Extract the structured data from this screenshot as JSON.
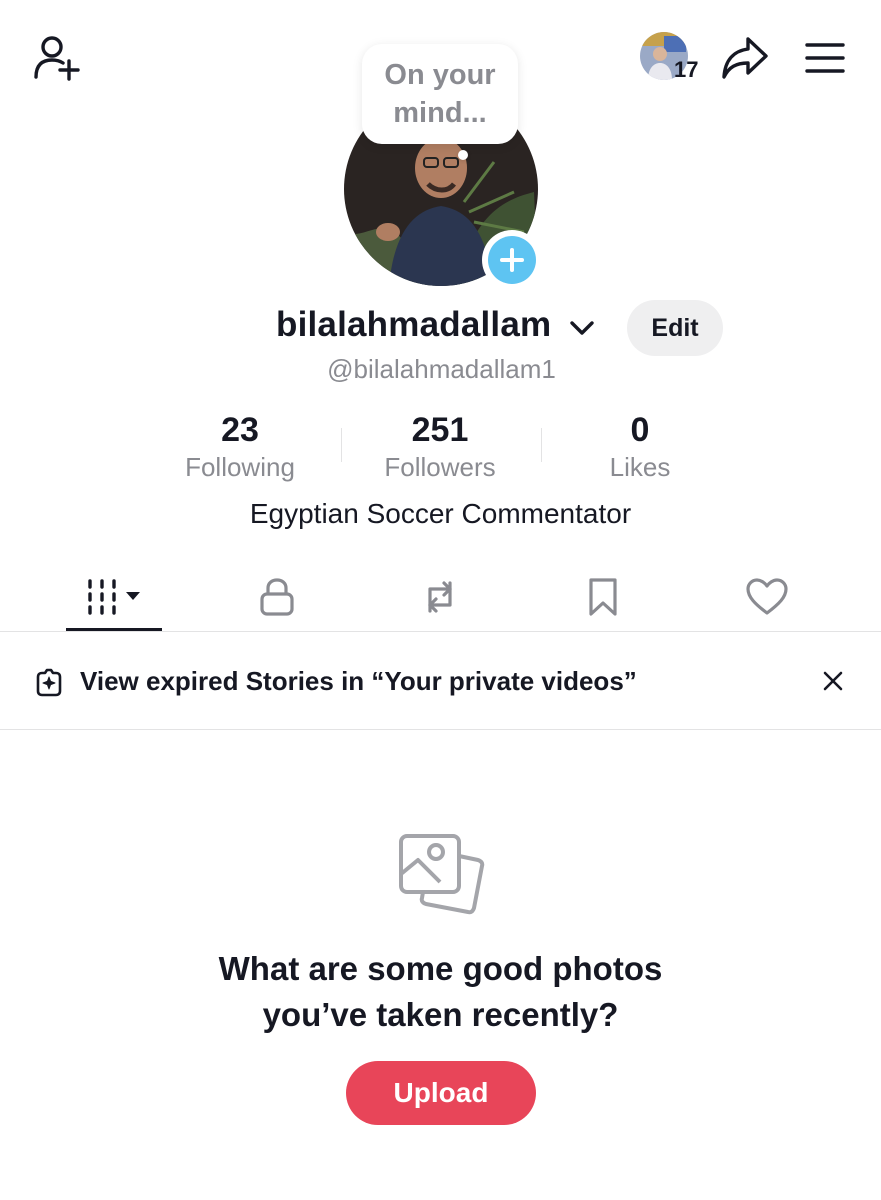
{
  "header": {
    "friends_count": "17"
  },
  "profile": {
    "bubble_line1": "On your",
    "bubble_line2": "mind...",
    "username": "bilalahmadallam",
    "handle": "@bilalahmadallam1",
    "edit_label": "Edit",
    "bio": "Egyptian Soccer Commentator"
  },
  "stats": [
    {
      "value": "23",
      "label": "Following"
    },
    {
      "value": "251",
      "label": "Followers"
    },
    {
      "value": "0",
      "label": "Likes"
    }
  ],
  "tabs": [
    {
      "icon": "videos-grid-icon"
    },
    {
      "icon": "lock-icon"
    },
    {
      "icon": "repost-icon"
    },
    {
      "icon": "bookmark-icon"
    },
    {
      "icon": "heart-icon"
    }
  ],
  "banner": {
    "text": "View expired Stories in “Your private videos”"
  },
  "empty_state": {
    "title_line1": "What are some good photos",
    "title_line2": "you’ve taken recently?",
    "upload_label": "Upload"
  },
  "colors": {
    "accent": "#e84559",
    "avatar_add": "#5ec4f2",
    "muted_text": "#8a8b91"
  }
}
